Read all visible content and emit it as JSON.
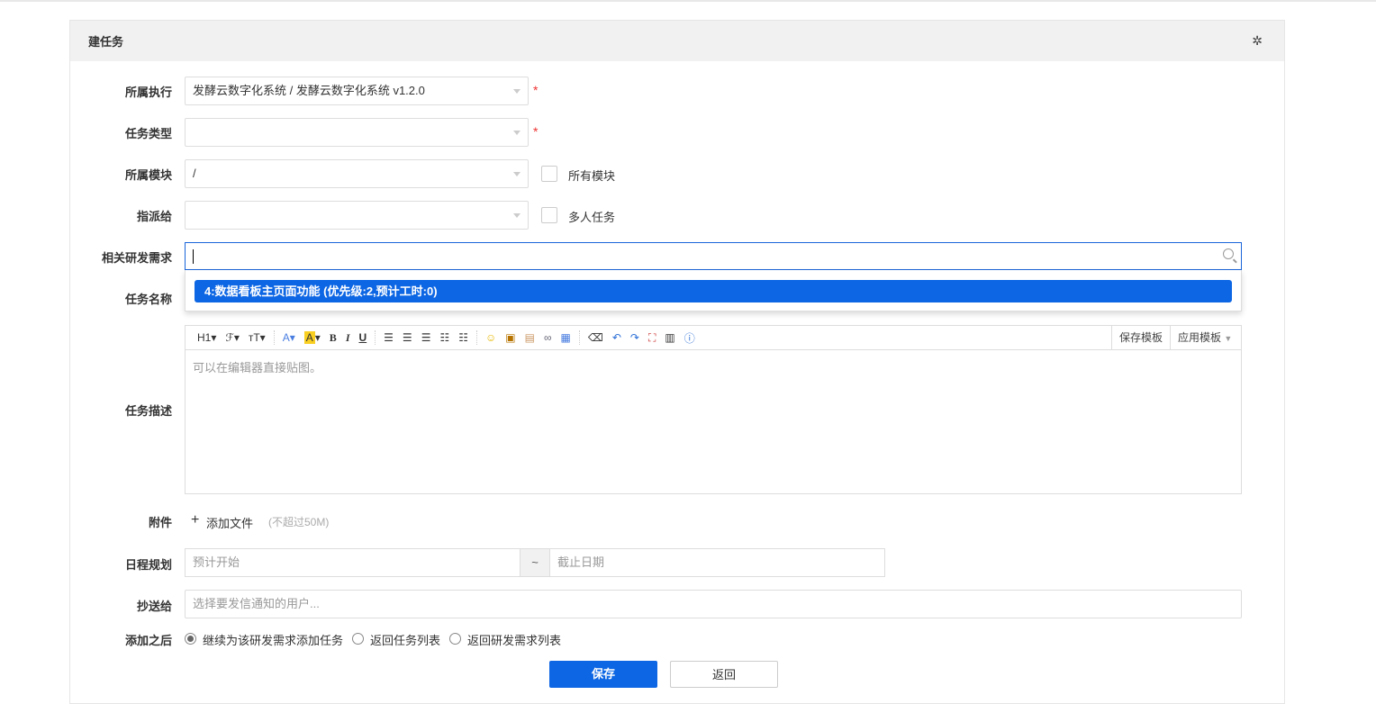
{
  "panel": {
    "title": "建任务",
    "settings_icon": "gear-icon"
  },
  "fields": {
    "execution": {
      "label": "所属执行",
      "value": "发酵云数字化系统 / 发酵云数字化系统 v1.2.0",
      "required": "*"
    },
    "type": {
      "label": "任务类型",
      "value": "",
      "required": "*"
    },
    "module": {
      "label": "所属模块",
      "value": "/",
      "checkbox": "所有模块"
    },
    "assign": {
      "label": "指派给",
      "value": "",
      "checkbox": "多人任务"
    },
    "story": {
      "label": "相关研发需求",
      "value": "",
      "option": "4:数据看板主页面功能 (优先级:2,预计工时:0)"
    },
    "name": {
      "label": "任务名称"
    },
    "desc": {
      "label": "任务描述",
      "placeholder": "可以在编辑器直接贴图。",
      "save_tpl": "保存模板",
      "apply_tpl": "应用模板"
    },
    "attach": {
      "label": "附件",
      "add": "添加文件",
      "hint": "(不超过50M)"
    },
    "schedule": {
      "label": "日程规划",
      "start": "预计开始",
      "sep": "~",
      "end": "截止日期"
    },
    "cc": {
      "label": "抄送给",
      "placeholder": "选择要发信通知的用户..."
    },
    "after": {
      "label": "添加之后",
      "options": [
        "继续为该研发需求添加任务",
        "返回任务列表",
        "返回研发需求列表"
      ],
      "selected": 0
    }
  },
  "toolbar": [
    "H1",
    "ℱ",
    "тT",
    "A",
    "A",
    "B",
    "I",
    "U"
  ],
  "actions": {
    "save": "保存",
    "back": "返回"
  },
  "colors": {
    "primary": "#0d66e4",
    "required": "#e33333"
  }
}
